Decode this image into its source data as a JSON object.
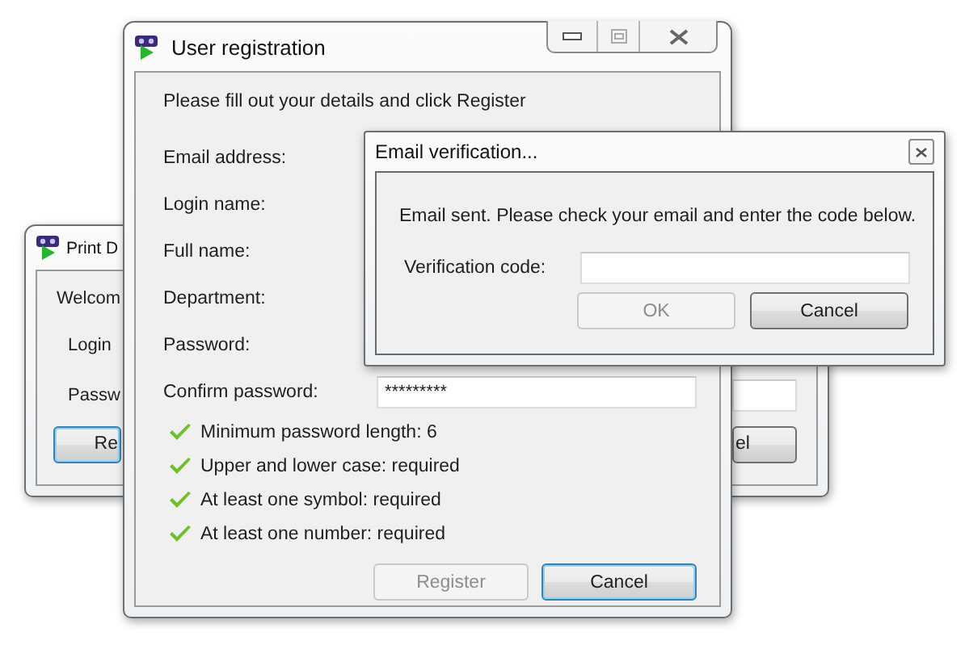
{
  "back_window": {
    "title": "Print D",
    "welcome": "Welcom",
    "labels": [
      "Login",
      "Passw"
    ],
    "buttons": [
      {
        "label": "Re",
        "focused": true
      },
      {
        "label": "el",
        "focused": false
      }
    ]
  },
  "registration": {
    "title": "User registration",
    "intro": "Please fill out your details and click Register",
    "labels": [
      "Email address:",
      "Login name:",
      "Full name:",
      "Department:",
      "Password:",
      "Confirm password:"
    ],
    "confirm_password_value": "*********",
    "rules": [
      {
        "text": "Minimum password length: 6",
        "met": true
      },
      {
        "text": "Upper and lower case: required",
        "met": true
      },
      {
        "text": "At least one symbol: required",
        "met": true
      },
      {
        "text": "At least one number: required",
        "met": true
      }
    ],
    "buttons": [
      {
        "label": "Register",
        "disabled": true,
        "focused": false
      },
      {
        "label": "Cancel",
        "disabled": false,
        "focused": true
      }
    ]
  },
  "dialog": {
    "title": "Email verification...",
    "message": "Email sent. Please check your email and enter the code below.",
    "field_label": "Verification code:",
    "buttons": [
      {
        "label": "OK",
        "disabled": true
      },
      {
        "label": "Cancel",
        "disabled": false
      }
    ]
  }
}
